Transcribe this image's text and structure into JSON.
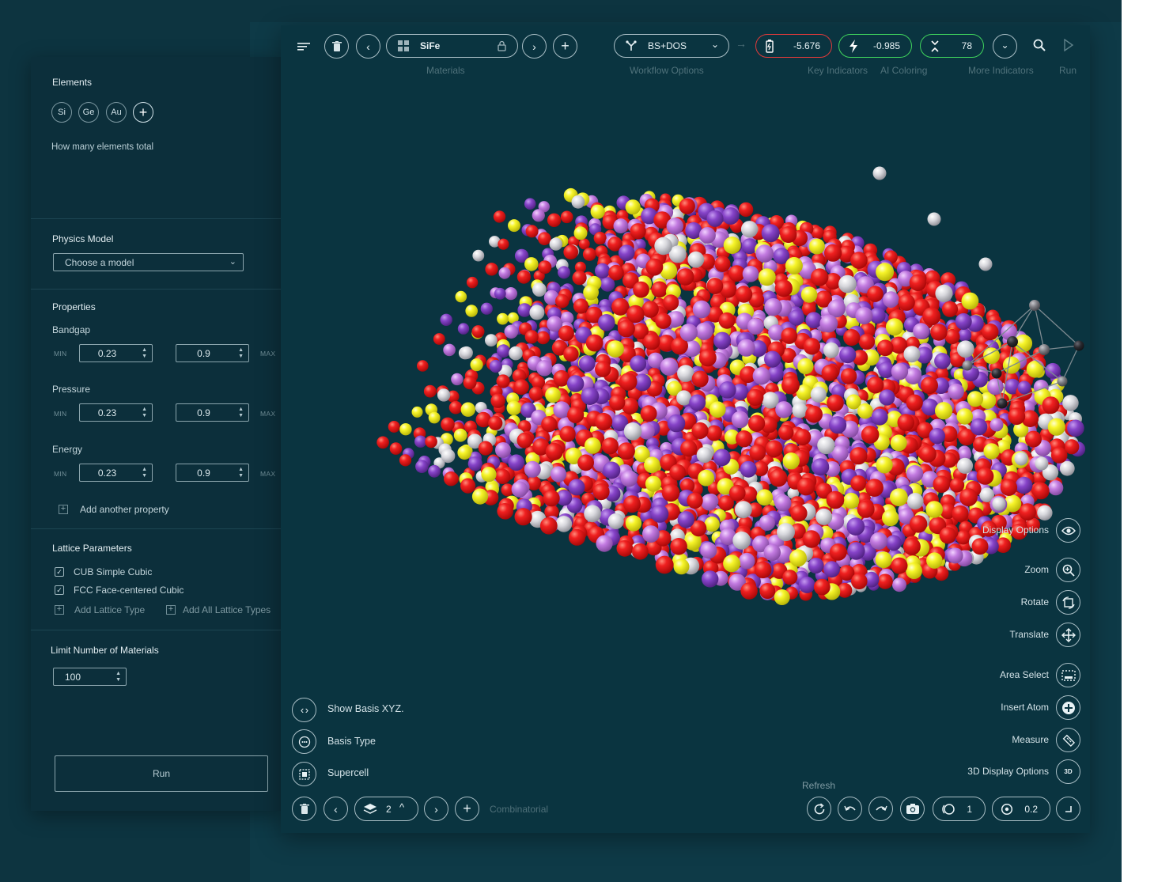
{
  "left_panel": {
    "elements": {
      "title": "Elements",
      "chips": [
        "Si",
        "Ge",
        "Au"
      ],
      "add_symbol": "+",
      "hint": "How many elements total"
    },
    "physics_model": {
      "title": "Physics Model",
      "select_value": "Choose a model"
    },
    "properties": {
      "title": "Properties",
      "min_label": "MIN",
      "max_label": "MAX",
      "items": [
        {
          "label": "Bandgap",
          "min": "0.23",
          "max": "0.9"
        },
        {
          "label": "Pressure",
          "min": "0.23",
          "max": "0.9"
        },
        {
          "label": "Energy",
          "min": "0.23",
          "max": "0.9"
        }
      ],
      "add_label": "Add another property"
    },
    "lattice": {
      "title": "Lattice Parameters",
      "options": [
        {
          "label": "CUB Simple Cubic",
          "checked": true
        },
        {
          "label": "FCC Face-centered Cubic",
          "checked": true
        }
      ],
      "add_type": "Add Lattice Type",
      "add_all": "Add All Lattice Types"
    },
    "limit": {
      "title": "Limit Number of Materials",
      "value": "100"
    },
    "run_label": "Run"
  },
  "toolbar": {
    "material_name": "SiFe",
    "materials_caption": "Materials",
    "workflow_value": "BS+DOS",
    "workflow_caption": "Workflow Options",
    "indicator_1": "-5.676",
    "indicator_1_color": "#e03a3a",
    "indicator_2": "-0.985",
    "indicator_2_color": "#3fd25c",
    "indicator_3": "78",
    "indicator_3_color": "#3fd25c",
    "key_indicators_caption": "Key Indicators",
    "ai_coloring_caption": "AI Coloring",
    "more_indicators_caption": "More Indicators",
    "run_caption": "Run"
  },
  "right_tools": [
    {
      "label": "Display Options",
      "icon": "eye-icon"
    },
    {
      "label": "Zoom",
      "icon": "zoom-icon"
    },
    {
      "label": "Rotate",
      "icon": "rotate-icon"
    },
    {
      "label": "Translate",
      "icon": "translate-icon"
    },
    {
      "label": "Area Select",
      "icon": "area-select-icon"
    },
    {
      "label": "Insert Atom",
      "icon": "insert-atom-icon"
    },
    {
      "label": "Measure",
      "icon": "ruler-icon"
    },
    {
      "label": "3D Display Options",
      "icon": "3d-icon",
      "icon_text": "3D"
    }
  ],
  "bottom_left": {
    "options": [
      "Show Basis XYZ.",
      "Basis Type",
      "Supercell"
    ],
    "layer_value": "2",
    "combinatorial_caption": "Combinatorial"
  },
  "bottom_right": {
    "refresh_caption": "Refresh",
    "field_1_value": "1",
    "field_2_value": "0.2"
  },
  "atom_colors": {
    "red": "#e81414",
    "yellow": "#f2f226",
    "purple": "#8a44c8",
    "violet": "#c27ae0",
    "white": "#e6e6ea"
  }
}
